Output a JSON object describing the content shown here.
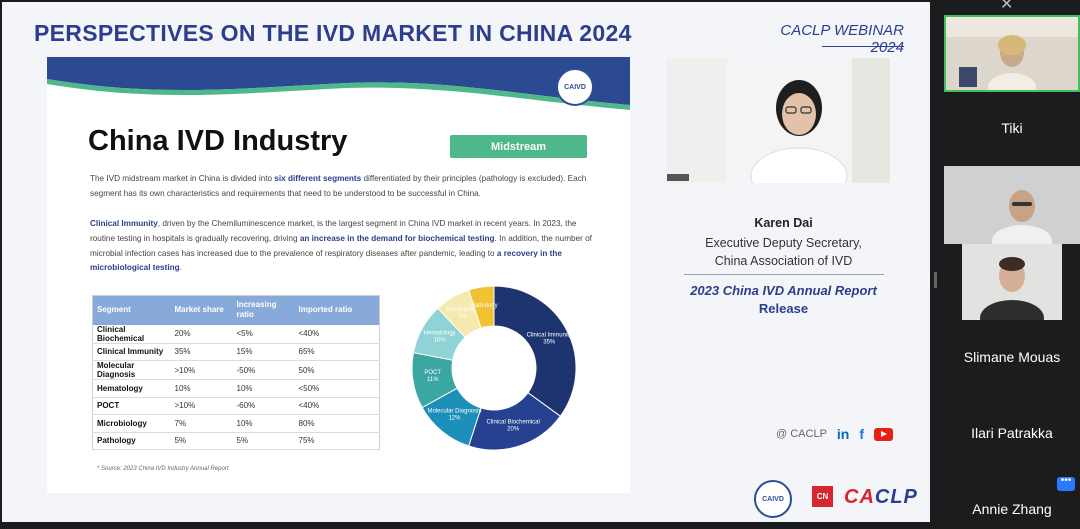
{
  "slide": {
    "title": "PERSPECTIVES ON THE IVD MARKET IN CHINA 2024",
    "webinar_line1": "CACLP WEBINAR",
    "webinar_line2": "2024",
    "inner": {
      "logo_text": "CAIVD",
      "title": "China IVD Industry",
      "tag": "Midstream",
      "para1_a": "The IVD midstream market in China is divided into ",
      "para1_b": "six different segments",
      "para1_c": " differentiated by their principles (pathology is excluded). Each segment has its own characteristics and requirements that need to be understood to be successful in China.",
      "para2_a": "Clinical Immunity",
      "para2_b": ", driven by the Chemiluminescence market, is the largest segment in China IVD market in recent years. In 2023, the routine testing in hospitals is gradually recovering, driving ",
      "para2_c": "an increase in the demand for biochemical testing",
      "para2_d": ". In addition, the number of microbial infection cases has increased due to the prevalence of respiratory diseases after pandemic, leading to ",
      "para2_e": "a recovery in the microbiological testing",
      "para2_f": ".",
      "table": {
        "headers": [
          "Segment",
          "Market share",
          "Increasing ratio",
          "Imported ratio"
        ],
        "rows": [
          [
            "Clinical Biochemical",
            "20%",
            "<5%",
            "<40%"
          ],
          [
            "Clinical Immunity",
            "35%",
            "15%",
            "65%"
          ],
          [
            "Molecular Diagnosis",
            ">10%",
            "-50%",
            "50%"
          ],
          [
            "Hematology",
            "10%",
            "10%",
            "<50%"
          ],
          [
            "POCT",
            ">10%",
            "-60%",
            "<40%"
          ],
          [
            "Microbiology",
            "7%",
            "10%",
            "80%"
          ],
          [
            "Pathology",
            "5%",
            "5%",
            "75%"
          ]
        ]
      },
      "source": "* Source: 2023 China IVD Industry Annual Report"
    }
  },
  "chart_data": {
    "type": "pie",
    "donut": true,
    "slices": [
      {
        "label": "Clinical Immunity",
        "value": 35,
        "color": "#1e3470"
      },
      {
        "label": "Clinical Biochemical",
        "value": 20,
        "color": "#26418f"
      },
      {
        "label": "Molecular Diagnosis",
        "value": 12,
        "color": "#1c8fb8"
      },
      {
        "label": "POCT",
        "value": 11,
        "color": "#3aa7a3"
      },
      {
        "label": "Hematology",
        "value": 10,
        "color": "#8fd3d6"
      },
      {
        "label": "Microbiology",
        "value": 7,
        "color": "#f5e9ae"
      },
      {
        "label": "Pathology",
        "value": 5,
        "color": "#f1c232"
      }
    ],
    "label_texts": [
      "Clinical Immunity 35%",
      "Clinical Biochemical 20%",
      "Molecular Diagnosis 12%",
      "POCT 11%",
      "Hematology 10%",
      "Microbiology 7%",
      "Pathology"
    ]
  },
  "speaker": {
    "name": "Karen Dai",
    "role1": "Executive Deputy Secretary,",
    "role2": "China Association of IVD",
    "report1": "2023 China IVD Annual Report",
    "report2": "Release"
  },
  "social": {
    "handle": "@ CACLP",
    "linkedin": "in",
    "facebook": "f"
  },
  "logos": {
    "caivd": "CAIVD",
    "red": "CN",
    "caclp_a": "CA",
    "caclp_b": "CLP"
  },
  "participants": [
    {
      "name": ""
    },
    {
      "name": "Tiki"
    },
    {
      "name": ""
    },
    {
      "name": "Slimane Mouas"
    },
    {
      "name": "Ilari Patrakka"
    },
    {
      "name": "Annie Zhang"
    }
  ],
  "more_button": "•••"
}
